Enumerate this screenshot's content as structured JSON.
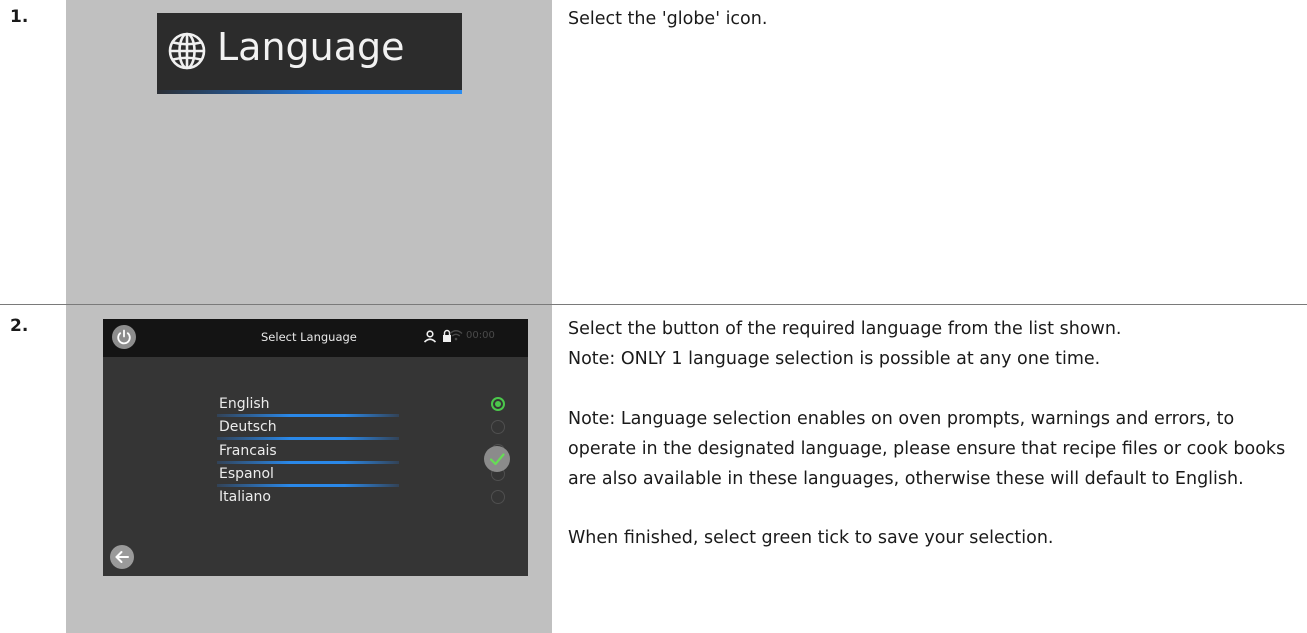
{
  "steps": [
    {
      "number": "1.",
      "banner_label": "Language",
      "description": [
        "Select the 'globe' icon."
      ]
    },
    {
      "number": "2.",
      "screen": {
        "title": "Select Language",
        "time": "00:00",
        "languages": [
          {
            "label": "English",
            "selected": true
          },
          {
            "label": "Deutsch",
            "selected": false
          },
          {
            "label": "Francais",
            "selected": false
          },
          {
            "label": "Espanol",
            "selected": false
          },
          {
            "label": "Italiano",
            "selected": false
          }
        ]
      },
      "description": [
        "Select the button of the required language from the list shown.",
        "Note: ONLY 1 language selection is possible at any one time.",
        "Note: Language selection enables on oven prompts, warnings and errors, to operate in the designated language, please ensure that recipe files or cook books are also available in these languages, otherwise these will default to English.",
        "When finished, select green tick to save your selection."
      ]
    }
  ],
  "colors": {
    "panel_bg": "#c0c0c0",
    "screen_bg": "#353535",
    "accent_blue": "#2a88e8",
    "select_green": "#4bc84b"
  },
  "icons": [
    "globe-icon",
    "power-icon",
    "user-icon",
    "lock-icon",
    "wifi-icon",
    "checkmark-icon",
    "back-arrow-icon"
  ]
}
